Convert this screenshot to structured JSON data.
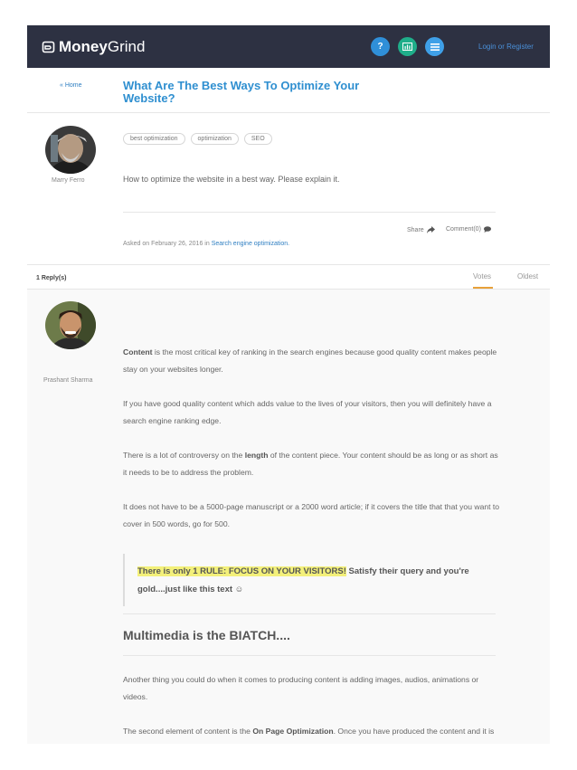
{
  "header": {
    "logo_bold": "Money",
    "logo_light": "Grind",
    "icons": [
      "question-icon",
      "chart-icon",
      "list-icon"
    ],
    "icon_q": "?",
    "login": "Login or Register",
    "bg_color": "#2d3142"
  },
  "question": {
    "home_link": "« Home",
    "title": "What Are The Best Ways To Optimize Your Website?",
    "author": "Marry Ferro",
    "tags": [
      "best optimization",
      "optimization",
      "SEO"
    ],
    "body": "How to optimize the website in a best way. Please explain it.",
    "share": "Share",
    "comment": "Comment(0)",
    "asked_prefix": "Asked on February 26, 2016 in",
    "asked_category": "Search engine optimization."
  },
  "replies": {
    "count": "1 Reply(s)",
    "sort_votes": "Votes",
    "sort_oldest": "Oldest"
  },
  "answer": {
    "author": "Prashant Sharma",
    "p1_bold": "Content",
    "p1_rest": " is the most critical key of ranking in the search engines because good quality content makes people stay on your websites longer.",
    "p2": "If you have good quality content which adds value to the lives of your visitors, then you will definitely have a search engine ranking edge.",
    "p3_a": "There is a lot of controversy on the ",
    "p3_bold": "length",
    "p3_b": " of the content piece. Your content should be as long or as short as it needs to be to address the problem.",
    "p4": "It does not have to be a 5000-page manuscript or a 2000 word article; if it covers the title that that you want to cover in 500 words, go for 500.",
    "quote_highlight": "There is only 1 RULE: FOCUS ON YOUR VISITORS!",
    "quote_rest": " Satisfy their query and you're gold....just like this text ☺",
    "heading": "Multimedia is the BIATCH....",
    "p5": "Another thing you could do when it comes to producing content is adding images, audios, animations or videos.",
    "p6_a": "The second element of content is the ",
    "p6_bold": "On Page Optimization",
    "p6_b": ". Once you have produced the content and it is ready to be shared with the world, you have to optimize it to tell the"
  }
}
